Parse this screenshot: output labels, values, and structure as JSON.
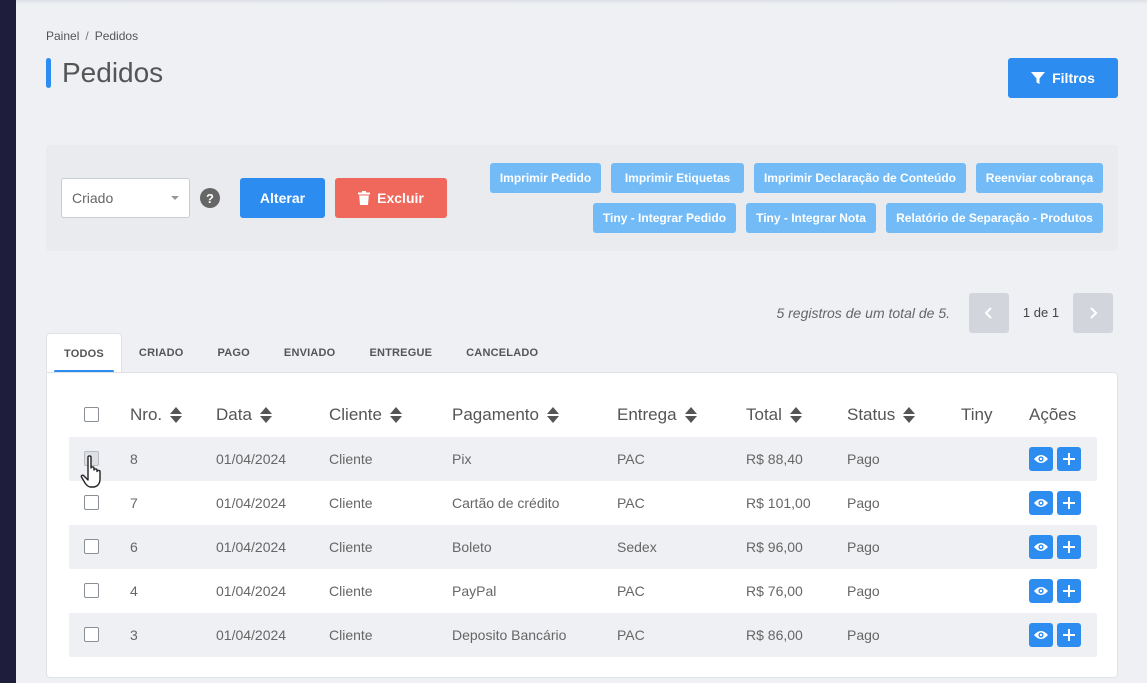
{
  "breadcrumb": {
    "home": "Painel",
    "separator": "/",
    "current": "Pedidos"
  },
  "page_title": "Pedidos",
  "filters_button": "Filtros",
  "bulk_action": {
    "status_select_value": "Criado",
    "help": "?",
    "alter_label": "Alterar",
    "delete_label": "Excluir"
  },
  "actions": {
    "print_order": "Imprimir Pedido",
    "print_labels": "Imprimir Etiquetas",
    "print_declaration": "Imprimir Declaração de Conteúdo",
    "resend_charge": "Reenviar cobrança",
    "tiny_order": "Tiny - Integrar Pedido",
    "tiny_invoice": "Tiny - Integrar Nota",
    "separation_report": "Relatório de Separação - Produtos"
  },
  "pagination": {
    "records_text": "5 registros de um total de 5.",
    "page_text": "1 de 1"
  },
  "tabs": [
    "TODOS",
    "CRIADO",
    "PAGO",
    "ENVIADO",
    "ENTREGUE",
    "CANCELADO"
  ],
  "table": {
    "headers": {
      "number": "Nro.",
      "date": "Data",
      "client": "Cliente",
      "payment": "Pagamento",
      "delivery": "Entrega",
      "total": "Total",
      "status": "Status",
      "tiny": "Tiny",
      "actions": "Ações"
    },
    "rows": [
      {
        "number": "8",
        "date": "01/04/2024",
        "client": "Cliente",
        "payment": "Pix",
        "delivery": "PAC",
        "total": "R$ 88,40",
        "status": "Pago"
      },
      {
        "number": "7",
        "date": "01/04/2024",
        "client": "Cliente",
        "payment": "Cartão de crédito",
        "delivery": "PAC",
        "total": "R$ 101,00",
        "status": "Pago"
      },
      {
        "number": "6",
        "date": "01/04/2024",
        "client": "Cliente",
        "payment": "Boleto",
        "delivery": "Sedex",
        "total": "R$ 96,00",
        "status": "Pago"
      },
      {
        "number": "4",
        "date": "01/04/2024",
        "client": "Cliente",
        "payment": "PayPal",
        "delivery": "PAC",
        "total": "R$ 76,00",
        "status": "Pago"
      },
      {
        "number": "3",
        "date": "01/04/2024",
        "client": "Cliente",
        "payment": "Deposito Bancário",
        "delivery": "PAC",
        "total": "R$ 86,00",
        "status": "Pago"
      }
    ]
  },
  "colors": {
    "primary": "#2d8cf0",
    "light_primary": "#73bbf7",
    "danger": "#f0685c",
    "sidebar": "#1e1d3b",
    "background": "#eef0f4"
  },
  "icons": [
    "filter-icon",
    "trash-icon",
    "chevron-left-icon",
    "chevron-right-icon",
    "eye-icon",
    "plus-icon",
    "help-icon",
    "pointer-cursor-icon"
  ]
}
